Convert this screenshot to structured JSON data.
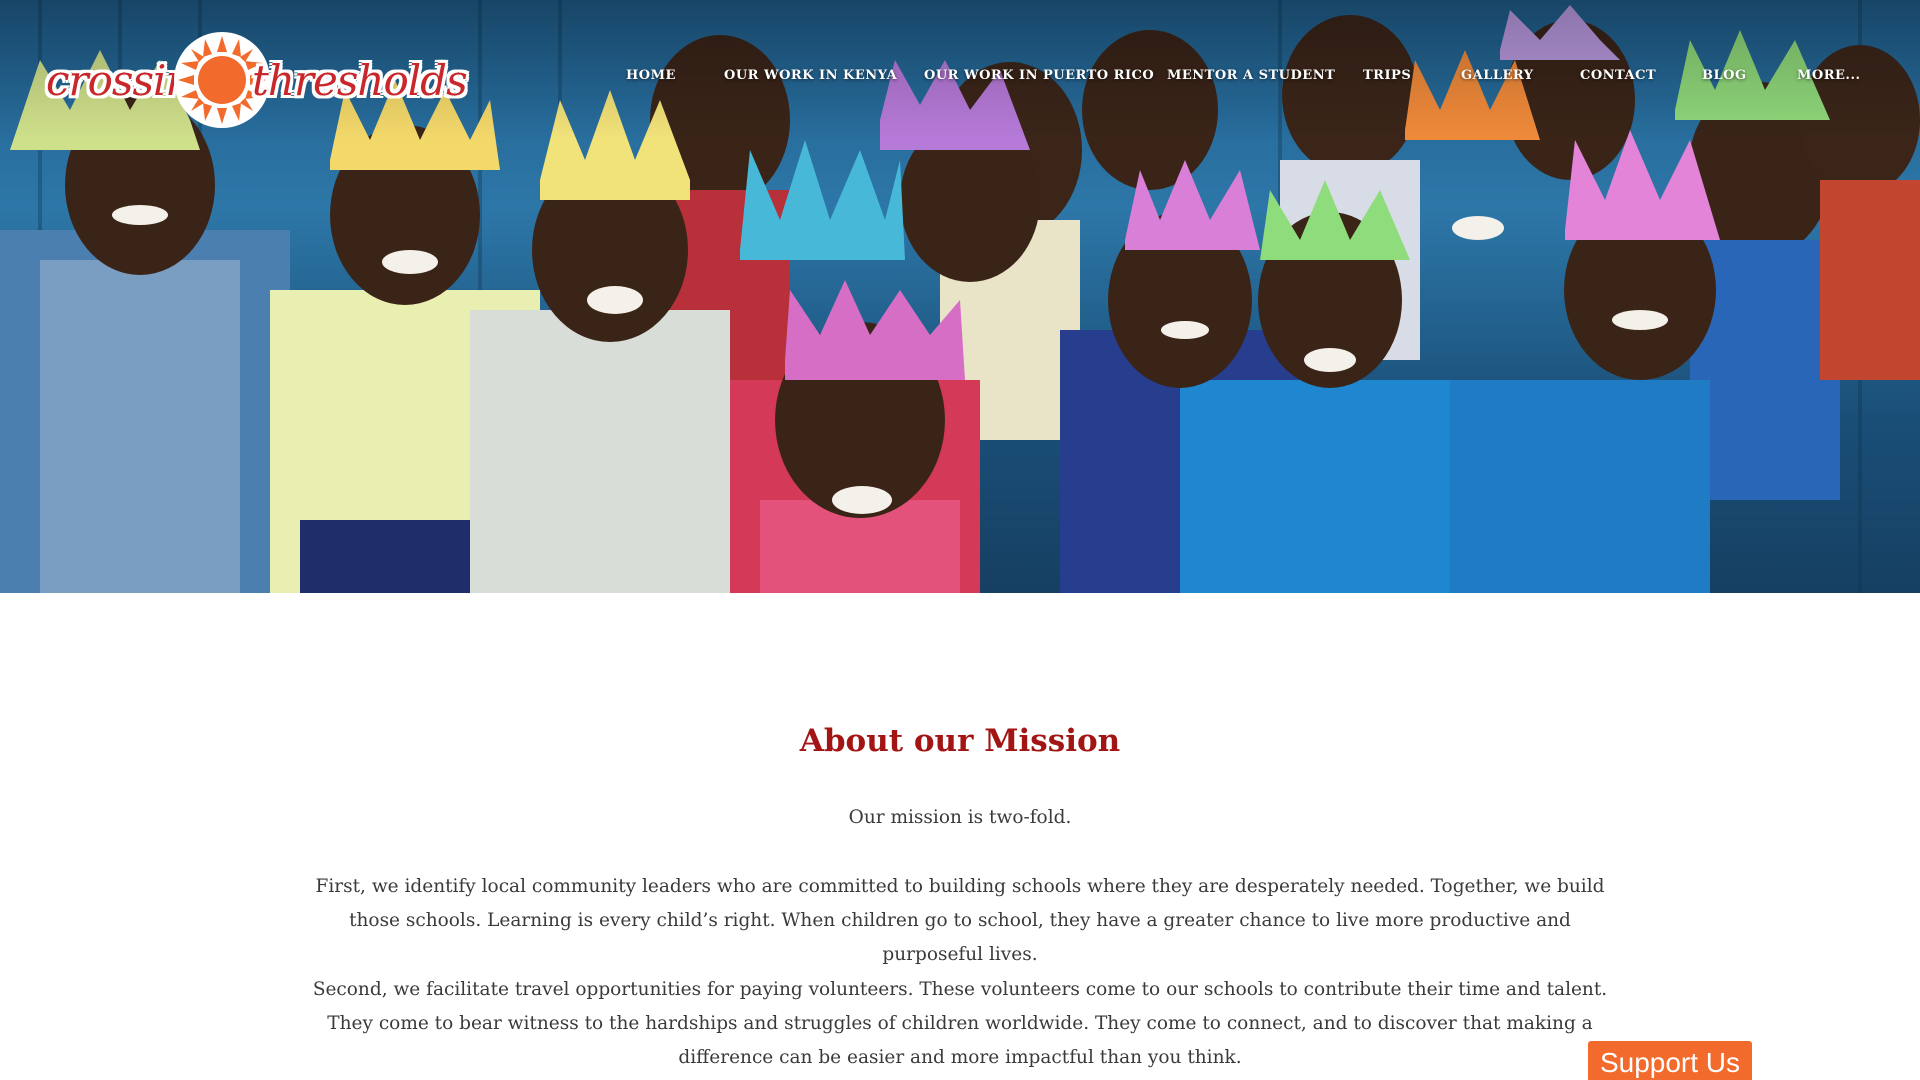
{
  "brand": {
    "word_left": "crossing",
    "word_right": "thresholds",
    "logo_color": "#c8282b",
    "sun_color": "#f26a2c"
  },
  "nav": {
    "items": [
      {
        "label": "HOME"
      },
      {
        "label": "OUR WORK IN KENYA"
      },
      {
        "label": "OUR WORK IN PUERTO RICO"
      },
      {
        "label": "MENTOR A STUDENT"
      },
      {
        "label": "TRIPS"
      },
      {
        "label": "GALLERY"
      },
      {
        "label": "CONTACT"
      },
      {
        "label": "BLOG"
      },
      {
        "label": "MORE..."
      }
    ]
  },
  "hero": {
    "image": "photo of smiling children wearing colorful paper crowns"
  },
  "mission": {
    "title": "About our Mission",
    "paragraphs": [
      "Our mission is two-fold.",
      "First, we identify local community leaders who are committed to building schools where they are desperately needed. Together, we build those schools. Learning is every child’s right. When children go to school, they have a greater chance to live more productive and purposeful lives.",
      "Second, we facilitate travel opportunities for paying volunteers. These volunteers come to our schools to contribute their time and talent. They come to bear witness to the hardships and struggles of children worldwide. They come to connect, and to discover that making a difference can be easier and more impactful than you think."
    ],
    "title_color": "#a31515"
  },
  "support_button": {
    "label": "Support Us",
    "color": "#f26a2c"
  }
}
